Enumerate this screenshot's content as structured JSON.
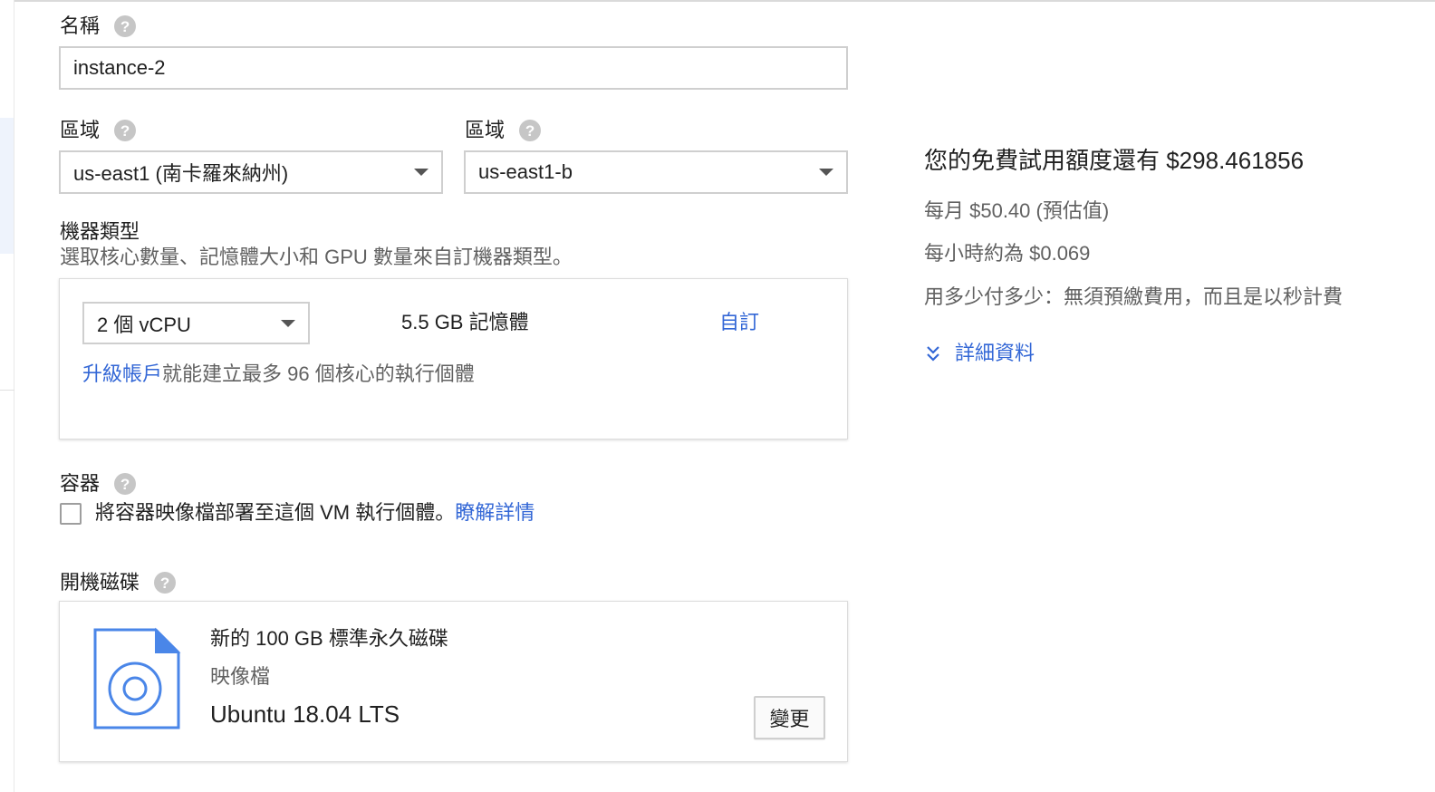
{
  "name_section": {
    "label": "名稱",
    "value": "instance-2"
  },
  "region": {
    "label": "區域",
    "value": "us-east1 (南卡羅來納州)"
  },
  "zone": {
    "label": "區域",
    "value": "us-east1-b"
  },
  "machine_type": {
    "label": "機器類型",
    "description": "選取核心數量、記憶體大小和 GPU 數量來自訂機器類型。",
    "cpu_value": "2 個 vCPU",
    "memory": "5.5 GB 記憶體",
    "customize_link": "自訂",
    "upgrade_link": "升級帳戶",
    "upgrade_text": "就能建立最多 96 個核心的執行個體"
  },
  "container": {
    "label": "容器",
    "checkbox_text": "將容器映像檔部署至這個 VM 執行個體。",
    "learn_more": "瞭解詳情"
  },
  "boot_disk": {
    "label": "開機磁碟",
    "disk_title": "新的 100 GB 標準永久磁碟",
    "image_label": "映像檔",
    "image_value": "Ubuntu 18.04 LTS",
    "change_button": "變更",
    "icon": "disk-image-icon"
  },
  "pricing": {
    "free_trial": "您的免費試用額度還有 $298.461856",
    "monthly": "每月 $50.40 (預估值)",
    "hourly": "每小時約為 $0.069",
    "billing_note": "用多少付多少：無須預繳費用，而且是以秒計費",
    "details_link": "詳細資料"
  },
  "colors": {
    "link": "#3367d6",
    "border": "#cfcfcf",
    "muted_text": "#616161",
    "help_icon": "#c6c6c6"
  }
}
